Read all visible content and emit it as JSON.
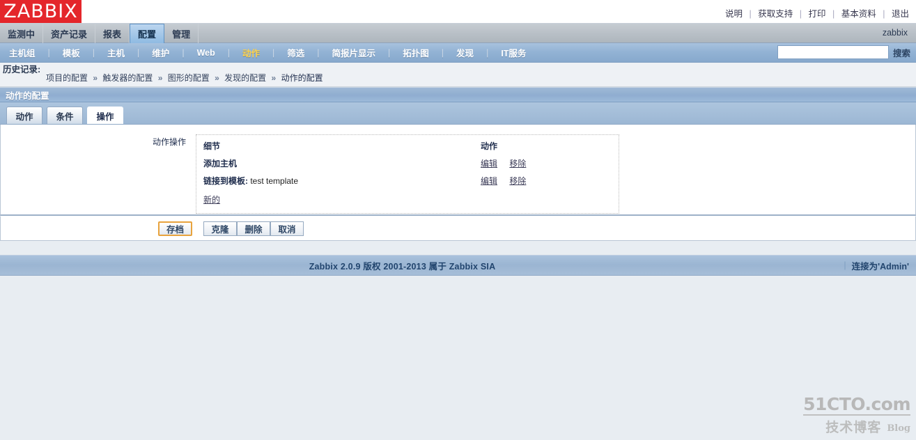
{
  "brand": {
    "logo_text": "ZABBIX",
    "logo_bg": "#e4262b"
  },
  "topbar": {
    "links": [
      {
        "label": "说明"
      },
      {
        "label": "获取支持"
      },
      {
        "label": "打印"
      },
      {
        "label": "基本资料"
      },
      {
        "label": "退出"
      }
    ],
    "separator": "|"
  },
  "mainnav": {
    "items": [
      {
        "label": "监测中",
        "active": false
      },
      {
        "label": "资产记录",
        "active": false
      },
      {
        "label": "报表",
        "active": false
      },
      {
        "label": "配置",
        "active": true
      },
      {
        "label": "管理",
        "active": false
      }
    ],
    "user": "zabbix",
    "active_color": "#8fbbe2"
  },
  "subnav": {
    "items": [
      {
        "label": "主机组",
        "active": false
      },
      {
        "label": "模板",
        "active": false
      },
      {
        "label": "主机",
        "active": false
      },
      {
        "label": "维护",
        "active": false
      },
      {
        "label": "Web",
        "active": false
      },
      {
        "label": "动作",
        "active": true
      },
      {
        "label": "筛选",
        "active": false
      },
      {
        "label": "简报片显示",
        "active": false
      },
      {
        "label": "拓扑图",
        "active": false
      },
      {
        "label": "发现",
        "active": false
      },
      {
        "label": "IT服务",
        "active": false
      }
    ],
    "divider": "|",
    "active_color": "#ffd24a",
    "search": {
      "value": "",
      "placeholder": "",
      "button_label": "搜索"
    }
  },
  "history": {
    "label": "历史记录:",
    "crumbs": [
      {
        "label": "项目的配置"
      },
      {
        "label": "触发器的配置"
      },
      {
        "label": "图形的配置"
      },
      {
        "label": "发现的配置"
      },
      {
        "label": "动作的配置"
      }
    ],
    "arrow": "»"
  },
  "page": {
    "title": "动作的配置"
  },
  "form_tabs": [
    {
      "label": "动作",
      "active": false
    },
    {
      "label": "条件",
      "active": false
    },
    {
      "label": "操作",
      "active": true
    }
  ],
  "main": {
    "field_label": "动作操作",
    "table": {
      "headers": {
        "detail": "细节",
        "action": "动作"
      },
      "rows": [
        {
          "detail_bold": "添加主机",
          "detail_value": "",
          "edit_label": "编辑",
          "remove_label": "移除"
        },
        {
          "detail_bold": "链接到模板:",
          "detail_value": "test template",
          "edit_label": "编辑",
          "remove_label": "移除"
        }
      ],
      "new_link": "新的"
    }
  },
  "buttons": {
    "save": "存档",
    "clone": "克隆",
    "delete": "删除",
    "cancel": "取消",
    "save_border_color": "#e8a33d"
  },
  "footer": {
    "copyright": "Zabbix 2.0.9 版权 2001-2013 属于 Zabbix SIA",
    "separator": "|",
    "connected_as": "连接为'Admin'"
  },
  "watermark": {
    "top": "51CTO.com",
    "cn": "技术博客",
    "blog": "Blog"
  }
}
